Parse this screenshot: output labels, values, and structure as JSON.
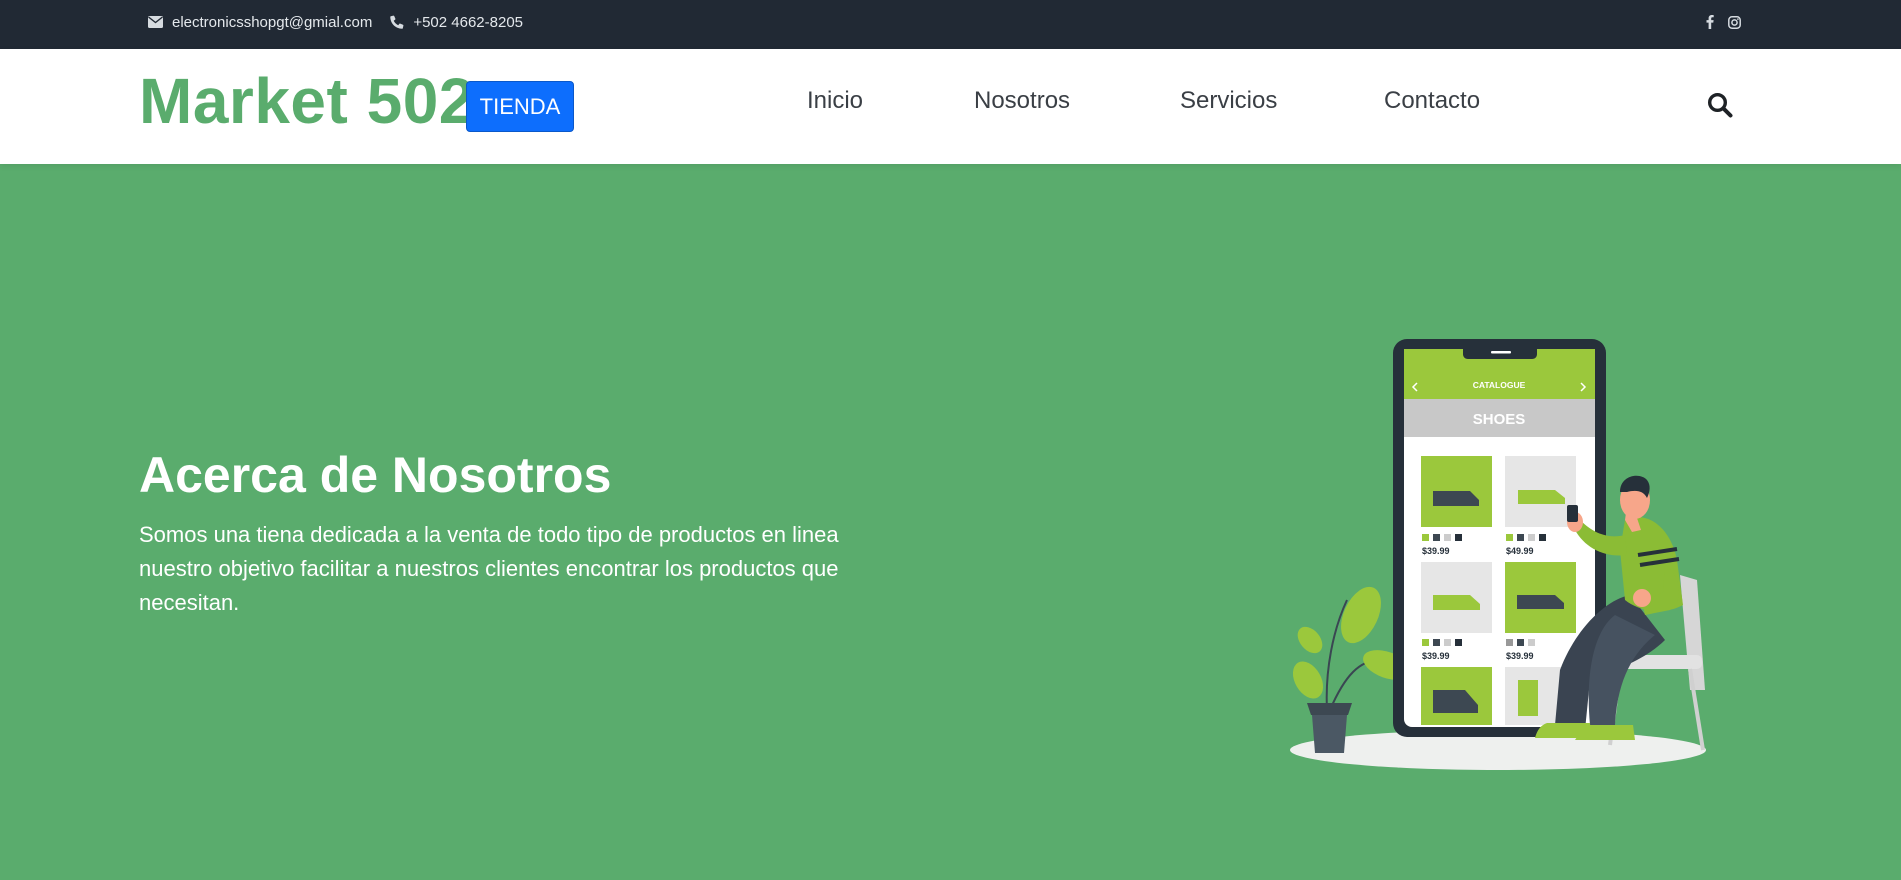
{
  "topbar": {
    "email": "electronicsshopgt@gmial.com",
    "phone": "+502 4662-8205",
    "email_icon": "envelope-icon",
    "phone_icon": "phone-icon",
    "social_icons": [
      "facebook-icon",
      "instagram-icon"
    ]
  },
  "navbar": {
    "brand": "Market 502",
    "store_button": "TIENDA",
    "links": [
      "Inicio",
      "Nosotros",
      "Servicios",
      "Contacto"
    ],
    "search_icon": "search-icon"
  },
  "hero": {
    "title": "Acerca de Nosotros",
    "text": "Somos una tiena dedicada a la venta de todo tipo de productos en linea nuestro objetivo facilitar a nuestros clientes encontrar los productos que necesitan."
  },
  "illustration": {
    "app_title": "CATALOGUE",
    "category": "SHOES",
    "prices": [
      "$39.99",
      "$49.99",
      "$39.99",
      "$39.99"
    ]
  },
  "colors": {
    "topbar_bg": "#212934",
    "brand_green": "#5aac6d",
    "button_blue": "#0d6efd",
    "accent_lime": "#9bc83c"
  }
}
